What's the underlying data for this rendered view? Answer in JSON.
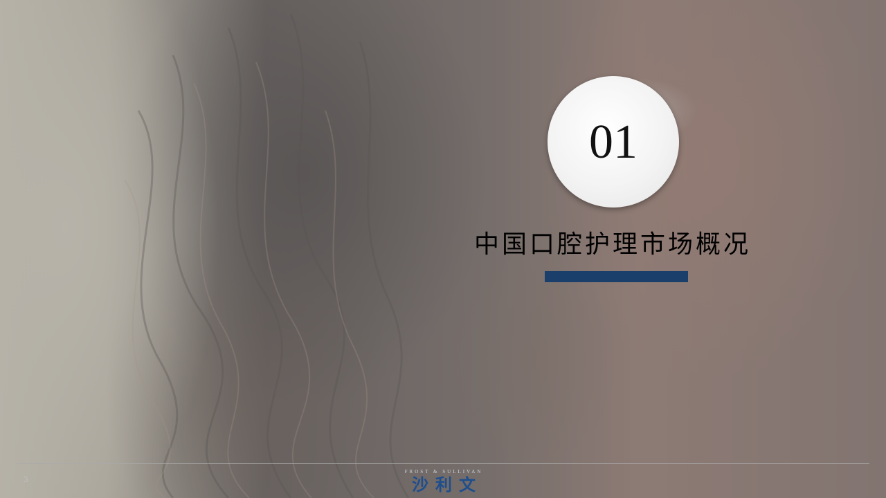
{
  "slide": {
    "section_number": "01",
    "section_title": "中国口腔护理市场概况",
    "page_number": "3"
  },
  "logo": {
    "english": "FROST & SULLIVAN",
    "chinese": "沙利文"
  },
  "colors": {
    "accent_bar": "#1a3f6b",
    "logo_blue": "#1f4e8c",
    "title_text": "#000000"
  }
}
